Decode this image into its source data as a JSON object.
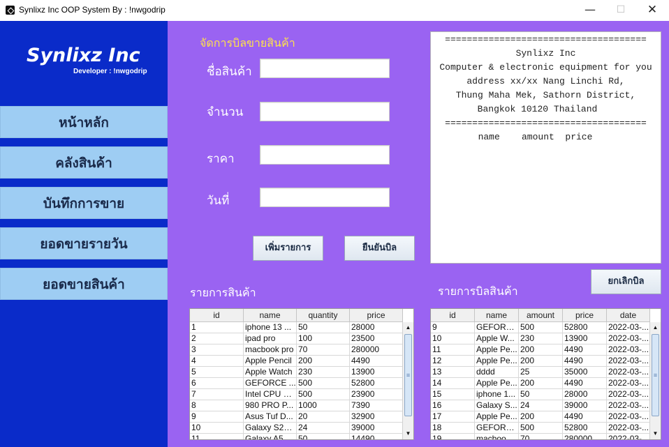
{
  "window": {
    "title": "Synlixz Inc OOP System By : !nwgodrip",
    "min": "—",
    "max": "☐",
    "close": "✕"
  },
  "sidebar": {
    "brand": "Synlixz Inc",
    "developer": "Developer : !nwgodrip",
    "items": [
      {
        "label": "หน้าหลัก"
      },
      {
        "label": "คลังสินค้า"
      },
      {
        "label": "บันทึกการขาย"
      },
      {
        "label": "ยอดขายรายวัน"
      },
      {
        "label": "ยอดขายสินค้า"
      }
    ]
  },
  "form": {
    "title": "จัดการบิลขายสินค้า",
    "name_label": "ชื่อสินค้า",
    "amount_label": "จำนวน",
    "price_label": "ราคา",
    "date_label": "วันที่",
    "name_value": "",
    "amount_value": "",
    "price_value": "",
    "date_value": "",
    "add_button": "เพิ่มรายการ",
    "confirm_button": "ยืนยันบิล",
    "cancel_button": "ยกเลิกบิล"
  },
  "receipt": {
    "lines": [
      "=====================================",
      "Synlixz Inc",
      "Computer & electronic equipment for you",
      "address xx/xx Nang Linchi Rd,",
      "Thung Maha Mek, Sathorn District,",
      "Bangkok 10120 Thailand",
      "=====================================",
      "name    amount  price"
    ]
  },
  "products": {
    "title": "รายการสินค้า",
    "columns": [
      "id",
      "name",
      "quantity",
      "price"
    ],
    "rows": [
      [
        "1",
        "iphone 13 ...",
        "50",
        "28000"
      ],
      [
        "2",
        "ipad pro",
        "100",
        "23500"
      ],
      [
        "3",
        "macbook pro",
        "70",
        "280000"
      ],
      [
        "4",
        "Apple Pencil",
        "200",
        "4490"
      ],
      [
        "5",
        "Apple Watch",
        "230",
        "13900"
      ],
      [
        "6",
        "GEFORCE ...",
        "500",
        "52800"
      ],
      [
        "7",
        "Intel CPU C...",
        "500",
        "23900"
      ],
      [
        "8",
        "980 PRO P...",
        "1000",
        "7390"
      ],
      [
        "9",
        "Asus Tuf D...",
        "20",
        "32900"
      ],
      [
        "10",
        "Galaxy S22 ...",
        "24",
        "39000"
      ],
      [
        "11",
        "Galaxy A52 ...",
        "50",
        "14490"
      ]
    ]
  },
  "bill": {
    "title": "รายการบิลสินค้า",
    "columns": [
      "id",
      "name",
      "amount",
      "price",
      "date"
    ],
    "rows": [
      [
        "9",
        "GEFORC...",
        "500",
        "52800",
        "2022-03-..."
      ],
      [
        "10",
        "Apple W...",
        "230",
        "13900",
        "2022-03-..."
      ],
      [
        "11",
        "Apple Pe...",
        "200",
        "4490",
        "2022-03-..."
      ],
      [
        "12",
        "Apple Pe...",
        "200",
        "4490",
        "2022-03-..."
      ],
      [
        "13",
        "dddd",
        "25",
        "35000",
        "2022-03-..."
      ],
      [
        "14",
        "Apple Pe...",
        "200",
        "4490",
        "2022-03-..."
      ],
      [
        "15",
        "iphone 1...",
        "50",
        "28000",
        "2022-03-..."
      ],
      [
        "16",
        "Galaxy S...",
        "24",
        "39000",
        "2022-03-..."
      ],
      [
        "17",
        "Apple Pe...",
        "200",
        "4490",
        "2022-03-..."
      ],
      [
        "18",
        "GEFORC...",
        "500",
        "52800",
        "2022-03-..."
      ],
      [
        "19",
        "macbook ...",
        "70",
        "280000",
        "2022-03-..."
      ]
    ]
  },
  "scroll": {
    "up": "▲",
    "down": "▼"
  }
}
